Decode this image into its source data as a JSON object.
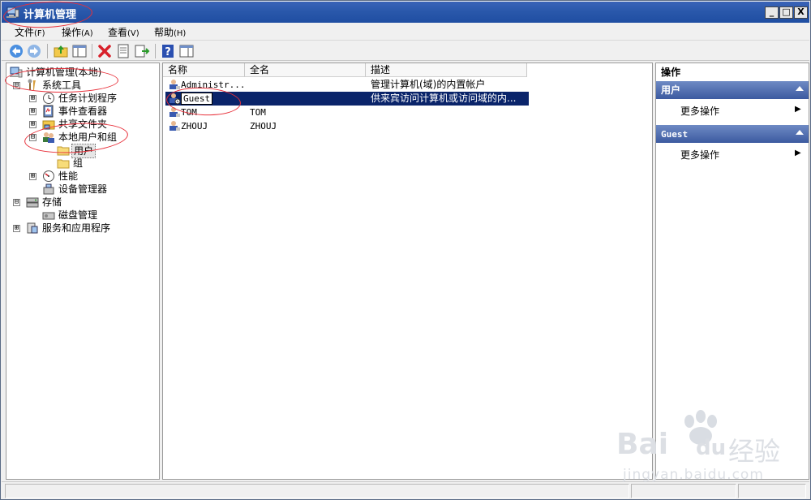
{
  "window": {
    "title": "计算机管理"
  },
  "title_buttons": {
    "minimize": "_",
    "maximize": "□",
    "close": "X"
  },
  "menu": [
    {
      "label": "文件",
      "hotkey": "(F)"
    },
    {
      "label": "操作",
      "hotkey": "(A)"
    },
    {
      "label": "查看",
      "hotkey": "(V)"
    },
    {
      "label": "帮助",
      "hotkey": "(H)"
    }
  ],
  "toolbar": {
    "icons": [
      "back-arrow-icon",
      "forward-arrow-icon",
      "up-folder-icon",
      "show-hide-tree-icon",
      "delete-icon",
      "properties-icon",
      "export-list-icon",
      "help-icon",
      "show-hide-action-pane-icon"
    ]
  },
  "tree": {
    "root": "计算机管理(本地)",
    "system_tools": "系统工具",
    "task_scheduler": "任务计划程序",
    "event_viewer": "事件查看器",
    "shared_folders": "共享文件夹",
    "local_users_groups": "本地用户和组",
    "users": "用户",
    "groups": "组",
    "performance": "性能",
    "device_manager": "设备管理器",
    "storage": "存储",
    "disk_management": "磁盘管理",
    "services_apps": "服务和应用程序",
    "expanded_glyph": "⊟",
    "collapsed_glyph": "⊞"
  },
  "columns": {
    "name": "名称",
    "full_name": "全名",
    "description": "描述"
  },
  "users": [
    {
      "name": "Administr...",
      "full_name": "",
      "description": "管理计算机(域)的内置帐户"
    },
    {
      "name": "Guest",
      "full_name": "",
      "description": "供来宾访问计算机或访问域的内..."
    },
    {
      "name": "TOM",
      "full_name": "TOM",
      "description": ""
    },
    {
      "name": "ZHOUJ",
      "full_name": "ZHOUJ",
      "description": ""
    }
  ],
  "selected_user_index": 1,
  "actions": {
    "title": "操作",
    "sections": [
      {
        "header": "用户",
        "item": "更多操作"
      },
      {
        "header": "Guest",
        "item": "更多操作"
      }
    ],
    "submenu_arrow": "▶"
  },
  "watermark": {
    "brand": "Bai",
    "brand_end": "du",
    "cn": "经验",
    "url": "jingyan.baidu.com"
  },
  "colors": {
    "titlebar": "#2a58ab",
    "selection": "#0a246a",
    "action_header": "#3c5aa0",
    "annotation": "#e8303a"
  }
}
